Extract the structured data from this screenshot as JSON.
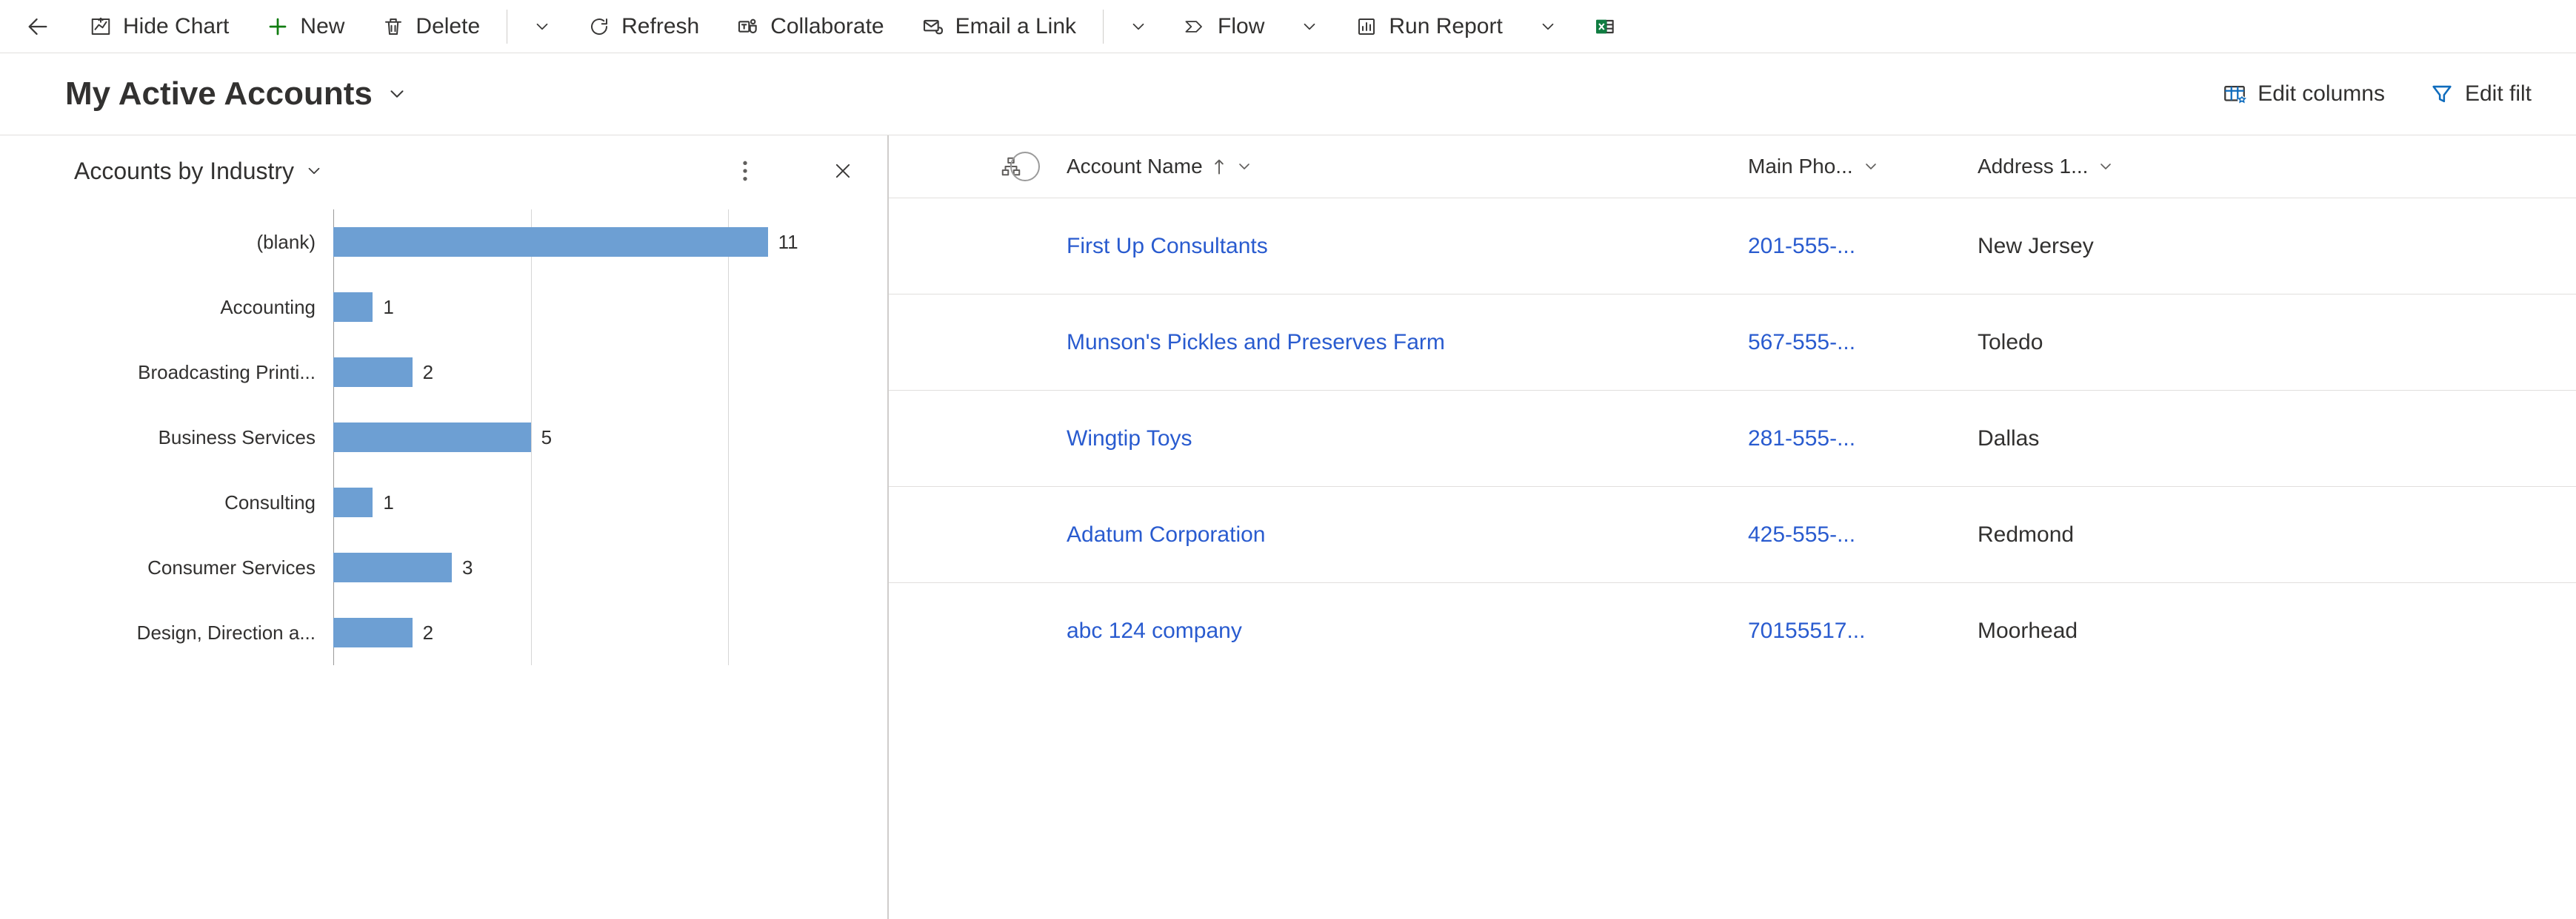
{
  "commands": {
    "hide_chart": "Hide Chart",
    "new": "New",
    "delete": "Delete",
    "refresh": "Refresh",
    "collaborate": "Collaborate",
    "email_link": "Email a Link",
    "flow": "Flow",
    "run_report": "Run Report"
  },
  "view": {
    "title": "My Active Accounts",
    "edit_columns": "Edit columns",
    "edit_filters": "Edit filt"
  },
  "chart": {
    "title": "Accounts by Industry"
  },
  "chart_data": {
    "type": "bar",
    "orientation": "horizontal",
    "title": "Accounts by Industry",
    "xlabel": "",
    "ylabel": "",
    "xlim": [
      0,
      12
    ],
    "categories": [
      "(blank)",
      "Accounting",
      "Broadcasting Printi...",
      "Business Services",
      "Consulting",
      "Consumer Services",
      "Design, Direction a..."
    ],
    "values": [
      11,
      1,
      2,
      5,
      1,
      3,
      2
    ]
  },
  "grid": {
    "columns": {
      "name": "Account Name",
      "phone": "Main Pho...",
      "city": "Address 1..."
    },
    "rows": [
      {
        "name": "First Up Consultants",
        "phone": "201-555-...",
        "city": "New Jersey"
      },
      {
        "name": "Munson's Pickles and Preserves Farm",
        "phone": "567-555-...",
        "city": "Toledo"
      },
      {
        "name": "Wingtip Toys",
        "phone": "281-555-...",
        "city": "Dallas"
      },
      {
        "name": "Adatum Corporation",
        "phone": "425-555-...",
        "city": "Redmond"
      },
      {
        "name": "abc 124 company",
        "phone": "70155517...",
        "city": "Moorhead"
      }
    ]
  }
}
